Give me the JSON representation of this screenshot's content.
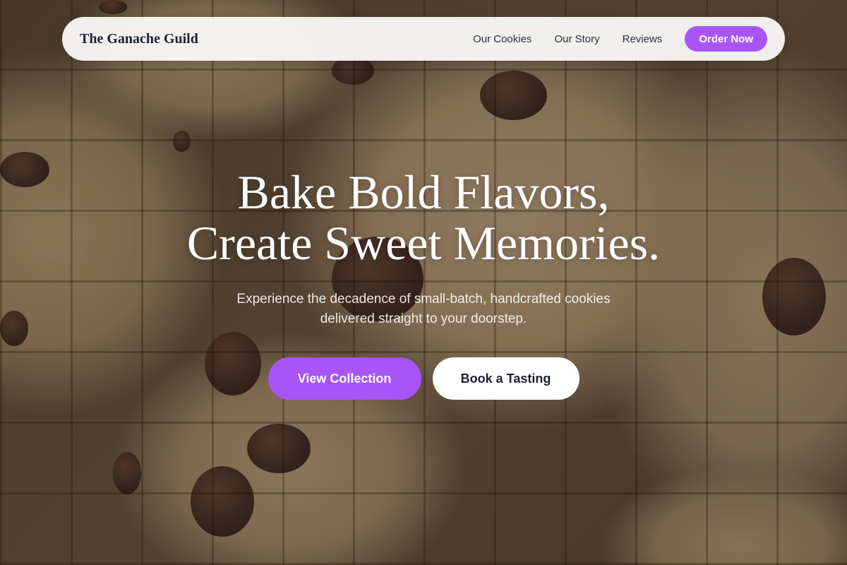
{
  "brand": "The Ganache Guild",
  "nav": {
    "links": [
      "Our Cookies",
      "Our Story",
      "Reviews"
    ],
    "cta": "Order Now"
  },
  "hero": {
    "headline_line1": "Bake Bold Flavors,",
    "headline_line2": "Create Sweet Memories.",
    "subtitle_line1": "Experience the decadence of small-batch, handcrafted cookies",
    "subtitle_line2": "delivered straight to your doorstep.",
    "primary_cta": "View Collection",
    "secondary_cta": "Book a Tasting"
  },
  "colors": {
    "accent": "#a855f7",
    "nav_background": "#f8f7f5",
    "brand_text": "#1c2233"
  },
  "background_image": "chocolate chip cookies on cooling rack"
}
